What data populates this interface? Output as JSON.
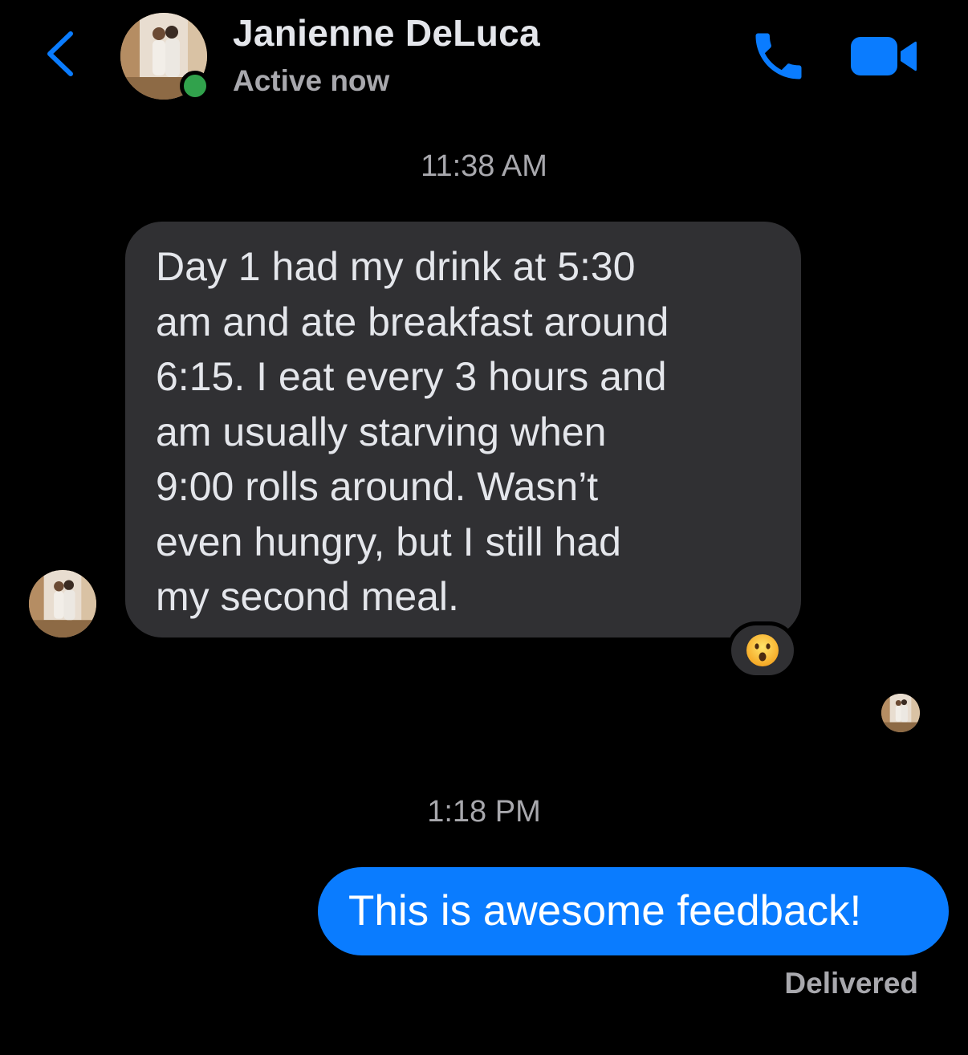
{
  "header": {
    "contact_name": "Janienne DeLuca",
    "status": "Active now",
    "presence_color": "#31a24c",
    "accent_color": "#0a7cff",
    "icons": [
      "back-chevron-icon",
      "phone-icon",
      "video-camera-icon"
    ]
  },
  "conversation": {
    "messages": [
      {
        "timestamp": "11:38 AM",
        "direction": "incoming",
        "lines": [
          "Day 1 had my drink at 5:30",
          "am and ate breakfast around",
          "6:15. I eat every 3 hours and",
          "am usually starving when",
          "9:00 rolls around. Wasn’t",
          "even hungry, but I still had",
          "my second meal."
        ],
        "reaction": "😮",
        "reaction_icon": "surprised-face-icon",
        "bubble_color": "#303033"
      },
      {
        "timestamp": "1:18 PM",
        "direction": "outgoing",
        "text": "This is awesome feedback!",
        "bubble_color": "#0a7cff",
        "receipt": "Delivered"
      }
    ]
  }
}
